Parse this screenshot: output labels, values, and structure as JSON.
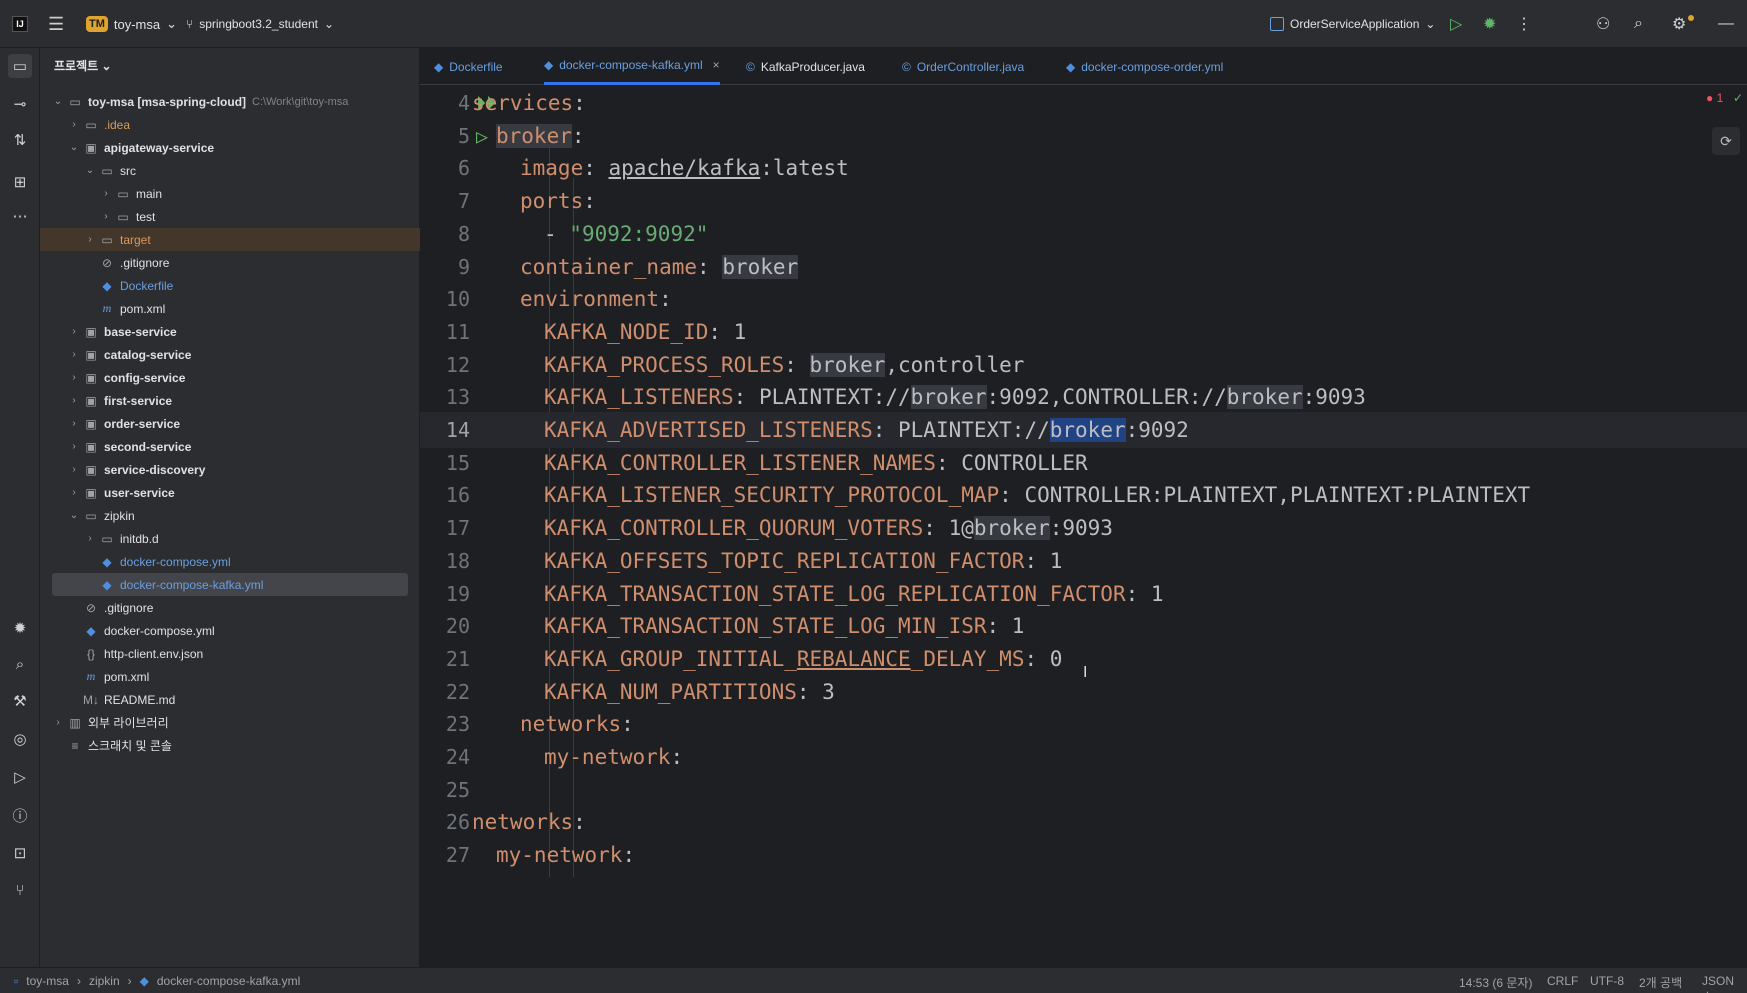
{
  "titlebar": {
    "logo": "IJ",
    "project_badge": "TM",
    "project_name": "toy-msa",
    "branch": "springboot3.2_student",
    "run_config": "OrderServiceApplication"
  },
  "left_strip_icons": [
    "folder-icon",
    "commit-icon",
    "pull-request-icon",
    "structure-icon",
    "more-icon",
    "debug-icon",
    "search-icon",
    "build-icon",
    "services-icon",
    "run-icon",
    "problems-icon",
    "terminal-icon",
    "git-icon"
  ],
  "project_panel": {
    "title": "프로젝트",
    "tree": [
      {
        "label": "toy-msa [msa-spring-cloud]",
        "path": "C:\\Work\\git\\toy-msa",
        "depth": 0,
        "arrow": "v",
        "icon": "folder",
        "style": "bold"
      },
      {
        "label": ".idea",
        "depth": 1,
        "arrow": ">",
        "icon": "folder",
        "style": "orange"
      },
      {
        "label": "apigateway-service",
        "depth": 1,
        "arrow": "v",
        "icon": "module",
        "style": "bold"
      },
      {
        "label": "src",
        "depth": 2,
        "arrow": "v",
        "icon": "folder",
        "style": ""
      },
      {
        "label": "main",
        "depth": 3,
        "arrow": ">",
        "icon": "folder",
        "style": ""
      },
      {
        "label": "test",
        "depth": 3,
        "arrow": ">",
        "icon": "folder",
        "style": ""
      },
      {
        "label": "target",
        "depth": 2,
        "arrow": ">",
        "icon": "folder",
        "style": "orange",
        "highlight": true
      },
      {
        "label": ".gitignore",
        "depth": 2,
        "arrow": "",
        "icon": "ignore",
        "style": ""
      },
      {
        "label": "Dockerfile",
        "depth": 2,
        "arrow": "",
        "icon": "docker",
        "style": "blue"
      },
      {
        "label": "pom.xml",
        "depth": 2,
        "arrow": "",
        "icon": "maven",
        "style": ""
      },
      {
        "label": "base-service",
        "depth": 1,
        "arrow": ">",
        "icon": "module",
        "style": "bold"
      },
      {
        "label": "catalog-service",
        "depth": 1,
        "arrow": ">",
        "icon": "module",
        "style": "bold"
      },
      {
        "label": "config-service",
        "depth": 1,
        "arrow": ">",
        "icon": "module",
        "style": "bold"
      },
      {
        "label": "first-service",
        "depth": 1,
        "arrow": ">",
        "icon": "module",
        "style": "bold"
      },
      {
        "label": "order-service",
        "depth": 1,
        "arrow": ">",
        "icon": "module",
        "style": "bold"
      },
      {
        "label": "second-service",
        "depth": 1,
        "arrow": ">",
        "icon": "module",
        "style": "bold"
      },
      {
        "label": "service-discovery",
        "depth": 1,
        "arrow": ">",
        "icon": "module",
        "style": "bold"
      },
      {
        "label": "user-service",
        "depth": 1,
        "arrow": ">",
        "icon": "module",
        "style": "bold"
      },
      {
        "label": "zipkin",
        "depth": 1,
        "arrow": "v",
        "icon": "folder",
        "style": ""
      },
      {
        "label": "initdb.d",
        "depth": 2,
        "arrow": ">",
        "icon": "folder",
        "style": ""
      },
      {
        "label": "docker-compose.yml",
        "depth": 2,
        "arrow": "",
        "icon": "docker",
        "style": "blue"
      },
      {
        "label": "docker-compose-kafka.yml",
        "depth": 2,
        "arrow": "",
        "icon": "docker",
        "style": "blue",
        "selected": true
      },
      {
        "label": ".gitignore",
        "depth": 1,
        "arrow": "",
        "icon": "ignore",
        "style": ""
      },
      {
        "label": "docker-compose.yml",
        "depth": 1,
        "arrow": "",
        "icon": "docker",
        "style": ""
      },
      {
        "label": "http-client.env.json",
        "depth": 1,
        "arrow": "",
        "icon": "json",
        "style": ""
      },
      {
        "label": "pom.xml",
        "depth": 1,
        "arrow": "",
        "icon": "maven",
        "style": ""
      },
      {
        "label": "README.md",
        "depth": 1,
        "arrow": "",
        "icon": "md",
        "style": ""
      },
      {
        "label": "외부 라이브러리",
        "depth": 0,
        "arrow": ">",
        "icon": "library",
        "style": ""
      },
      {
        "label": "스크래치 및 콘솔",
        "depth": 0,
        "arrow": "",
        "icon": "scratch",
        "style": ""
      }
    ]
  },
  "tabs": [
    {
      "label": "Dockerfile",
      "icon": "docker",
      "active": false
    },
    {
      "label": "docker-compose-kafka.yml",
      "icon": "docker",
      "active": true
    },
    {
      "label": "KafkaProducer.java",
      "icon": "java",
      "active": false
    },
    {
      "label": "OrderController.java",
      "icon": "java",
      "active": false
    },
    {
      "label": "docker-compose-order.yml",
      "icon": "docker",
      "active": false
    }
  ],
  "editor": {
    "error_count": "1",
    "lines": [
      {
        "n": "4",
        "run": true,
        "tokens": [
          [
            "k",
            "services"
          ],
          [
            "v",
            ":"
          ]
        ],
        "indent": 0
      },
      {
        "n": "5",
        "run": true,
        "tokens": [
          [
            "k hl",
            "broker"
          ],
          [
            "v",
            ":"
          ]
        ],
        "indent": 1
      },
      {
        "n": "6",
        "tokens": [
          [
            "k",
            "image"
          ],
          [
            "v",
            ": "
          ],
          [
            "v u",
            "apache/kafka"
          ],
          [
            "v",
            ":latest"
          ]
        ],
        "indent": 2
      },
      {
        "n": "7",
        "tokens": [
          [
            "k",
            "ports"
          ],
          [
            "v",
            ":"
          ]
        ],
        "indent": 2
      },
      {
        "n": "8",
        "tokens": [
          [
            "v",
            "- "
          ],
          [
            "s",
            "\"9092:9092\""
          ]
        ],
        "indent": 3
      },
      {
        "n": "9",
        "tokens": [
          [
            "k",
            "container_name"
          ],
          [
            "v",
            ": "
          ],
          [
            "v hl",
            "broker"
          ]
        ],
        "indent": 2
      },
      {
        "n": "10",
        "tokens": [
          [
            "k",
            "environment"
          ],
          [
            "v",
            ":"
          ]
        ],
        "indent": 2
      },
      {
        "n": "11",
        "tokens": [
          [
            "k",
            "KAFKA_NODE_ID"
          ],
          [
            "v",
            ": 1"
          ]
        ],
        "indent": 3
      },
      {
        "n": "12",
        "tokens": [
          [
            "k",
            "KAFKA_PROCESS_ROLES"
          ],
          [
            "v",
            ": "
          ],
          [
            "v hl",
            "broker"
          ],
          [
            "v",
            ",controller"
          ]
        ],
        "indent": 3
      },
      {
        "n": "13",
        "tokens": [
          [
            "k",
            "KAFKA_LISTENERS"
          ],
          [
            "v",
            ": PLAINTEXT://"
          ],
          [
            "v hl",
            "broker"
          ],
          [
            "v",
            ":9092,CONTROLLER://"
          ],
          [
            "v hl",
            "broker"
          ],
          [
            "v",
            ":9093"
          ]
        ],
        "indent": 3
      },
      {
        "n": "14",
        "current": true,
        "tokens": [
          [
            "k",
            "KAFKA_ADVERTISED_LISTENERS"
          ],
          [
            "v",
            ": PLAINTEXT://"
          ],
          [
            "v sel",
            "broker"
          ],
          [
            "v",
            ":9092"
          ]
        ],
        "indent": 3
      },
      {
        "n": "15",
        "tokens": [
          [
            "k",
            "KAFKA_CONTROLLER_LISTENER_NAMES"
          ],
          [
            "v",
            ": CONTROLLER"
          ]
        ],
        "indent": 3
      },
      {
        "n": "16",
        "tokens": [
          [
            "k",
            "KAFKA_LISTENER_SECURITY_PROTOCOL_MAP"
          ],
          [
            "v",
            ": CONTROLLER:PLAINTEXT,PLAINTEXT:PLAINTEXT"
          ]
        ],
        "indent": 3
      },
      {
        "n": "17",
        "tokens": [
          [
            "k",
            "KAFKA_CONTROLLER_QUORUM_VOTERS"
          ],
          [
            "v",
            ": 1@"
          ],
          [
            "v hl",
            "broker"
          ],
          [
            "v",
            ":9093"
          ]
        ],
        "indent": 3
      },
      {
        "n": "18",
        "tokens": [
          [
            "k",
            "KAFKA_OFFSETS_TOPIC_REPLICATION_FACTOR"
          ],
          [
            "v",
            ": 1"
          ]
        ],
        "indent": 3
      },
      {
        "n": "19",
        "tokens": [
          [
            "k",
            "KAFKA_TRANSACTION_STATE_LOG_REPLICATION_FACTOR"
          ],
          [
            "v",
            ": 1"
          ]
        ],
        "indent": 3
      },
      {
        "n": "20",
        "tokens": [
          [
            "k",
            "KAFKA_TRANSACTION_STATE_LOG_MIN_ISR"
          ],
          [
            "v",
            ": 1"
          ]
        ],
        "indent": 3
      },
      {
        "n": "21",
        "tokens": [
          [
            "k",
            "KAFKA_GROUP_INITIAL_"
          ],
          [
            "k u",
            "REBALANCE"
          ],
          [
            "k",
            "_DELAY_MS"
          ],
          [
            "v",
            ": 0"
          ]
        ],
        "indent": 3
      },
      {
        "n": "22",
        "tokens": [
          [
            "k",
            "KAFKA_NUM_PARTITIONS"
          ],
          [
            "v",
            ": 3"
          ]
        ],
        "indent": 3
      },
      {
        "n": "23",
        "tokens": [
          [
            "k",
            "networks"
          ],
          [
            "v",
            ":"
          ]
        ],
        "indent": 2
      },
      {
        "n": "24",
        "tokens": [
          [
            "k",
            "my-network"
          ],
          [
            "v",
            ":"
          ]
        ],
        "indent": 3
      },
      {
        "n": "25",
        "tokens": [],
        "indent": 0
      },
      {
        "n": "26",
        "tokens": [
          [
            "k",
            "networks"
          ],
          [
            "v",
            ":"
          ]
        ],
        "indent": 0
      },
      {
        "n": "27",
        "tokens": [
          [
            "k",
            "my-network"
          ],
          [
            "v",
            ":"
          ]
        ],
        "indent": 1
      }
    ]
  },
  "statusbar": {
    "breadcrumb": [
      "toy-msa",
      "zipkin",
      "docker-compose-kafka.yml"
    ],
    "position": "14:53 (6 문자)",
    "line_sep": "CRLF",
    "encoding": "UTF-8",
    "indent": "2개 공백",
    "schema": "JSON 스"
  }
}
